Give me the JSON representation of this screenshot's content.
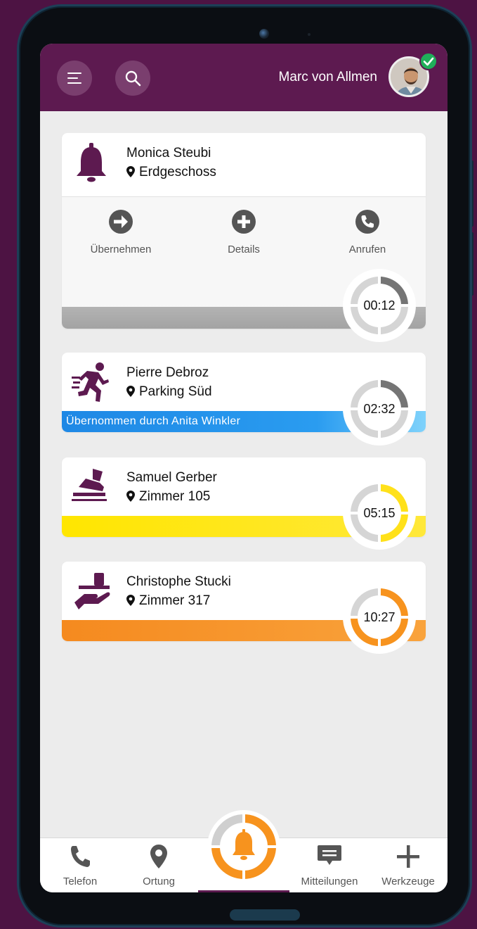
{
  "header": {
    "user_name": "Marc von Allmen",
    "menu_icon": "menu-icon",
    "search_icon": "search-icon",
    "status": "online-check-icon"
  },
  "alarms": [
    {
      "name": "Monica Steubi",
      "location": "Erdgeschoss",
      "icon": "bell-icon",
      "timer": "00:12",
      "timer_progress": 0.25,
      "color": "#a9a9a9",
      "expanded": true,
      "actions": [
        "Übernehmen",
        "Details",
        "Anrufen"
      ]
    },
    {
      "name": "Pierre Debroz",
      "location": "Parking Süd",
      "icon": "running-person-icon",
      "timer": "02:32",
      "timer_progress": 0.25,
      "color": "#2196f3",
      "status_text": "Übernommen durch Anita Winkler"
    },
    {
      "name": "Samuel Gerber",
      "location": "Zimmer 105",
      "icon": "shoe-step-icon",
      "timer": "05:15",
      "timer_progress": 0.5,
      "color": "#ffe11a"
    },
    {
      "name": "Christophe Stucki",
      "location": "Zimmer 317",
      "icon": "serving-hand-icon",
      "timer": "10:27",
      "timer_progress": 0.75,
      "color": "#f7931e"
    }
  ],
  "nav": {
    "items": [
      "Telefon",
      "Ortung",
      "Mitteilungen",
      "Werkzeuge"
    ],
    "active": "alarm-bell-button"
  },
  "colors": {
    "brand": "#5d1a50",
    "timer_track": "#d5d5d5"
  }
}
